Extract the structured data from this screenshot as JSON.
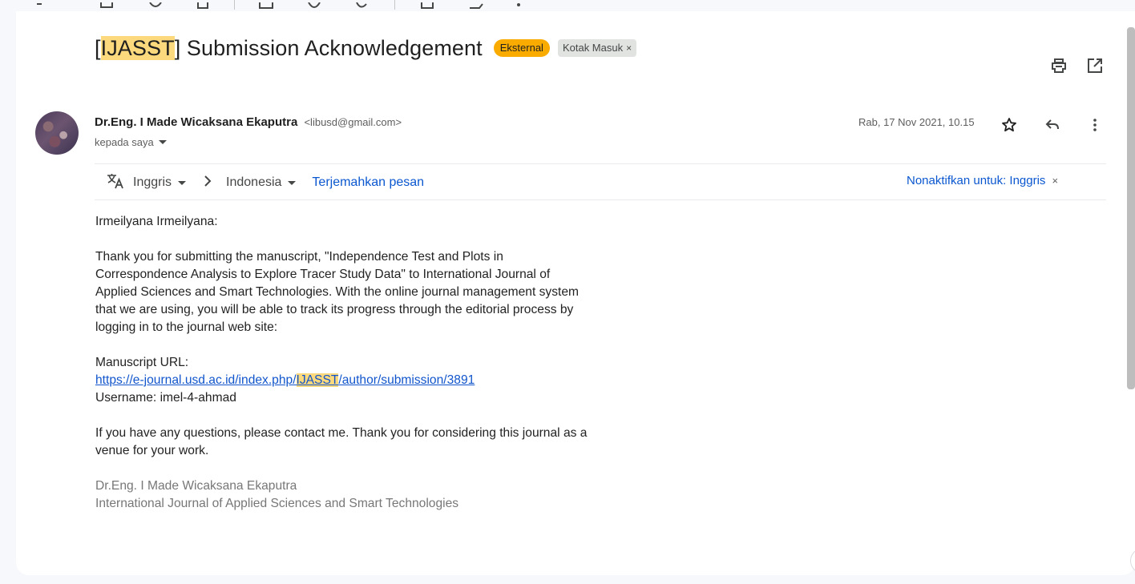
{
  "email": {
    "subject_prefix_bracket_open": "[",
    "subject_highlight": "IJASST",
    "subject_rest": "] Submission Acknowledgement",
    "label_external": "Eksternal",
    "label_inbox": "Kotak Masuk",
    "label_inbox_close": "×",
    "sender_name": "Dr.Eng. I Made Wicaksana Ekaputra",
    "sender_email": "<libusd@gmail.com>",
    "recipient_text": "kepada saya",
    "date": "Rab, 17 Nov 2021, 10.15"
  },
  "translate": {
    "source_lang": "Inggris",
    "target_lang": "Indonesia",
    "translate_label": "Terjemahkan pesan",
    "disable_label": "Nonaktifkan untuk: Inggris",
    "disable_close": "×"
  },
  "body": {
    "greeting": "Irmeilyana Irmeilyana:",
    "paragraph1": "Thank you for submitting the manuscript, \"Independence Test and Plots in Correspondence Analysis to Explore Tracer Study Data\" to International Journal of Applied Sciences and Smart Technologies. With the online journal management system that we are using, you will be able to track its progress through the editorial process by logging in to the journal web site:",
    "manuscript_url_label": "Manuscript URL:",
    "url_before": "https://e-journal.usd.ac.id/index.php/",
    "url_highlight": "IJASST",
    "url_after": "/author/submission/3891",
    "username_line": "Username: imel-4-ahmad",
    "paragraph2": "If you have any questions, please contact me. Thank you for considering this journal as a venue for your work.",
    "signature_name": "Dr.Eng. I Made Wicaksana Ekaputra",
    "signature_org": "International Journal of Applied Sciences and Smart Technologies"
  },
  "colors": {
    "highlight": "#fcd97d",
    "external_badge": "#f9ab00",
    "link": "#0b57d0"
  },
  "icons": [
    "print-icon",
    "open-in-new-window-icon",
    "star-icon",
    "reply-icon",
    "more-options-icon",
    "translate-icon",
    "chevron-right-icon"
  ]
}
